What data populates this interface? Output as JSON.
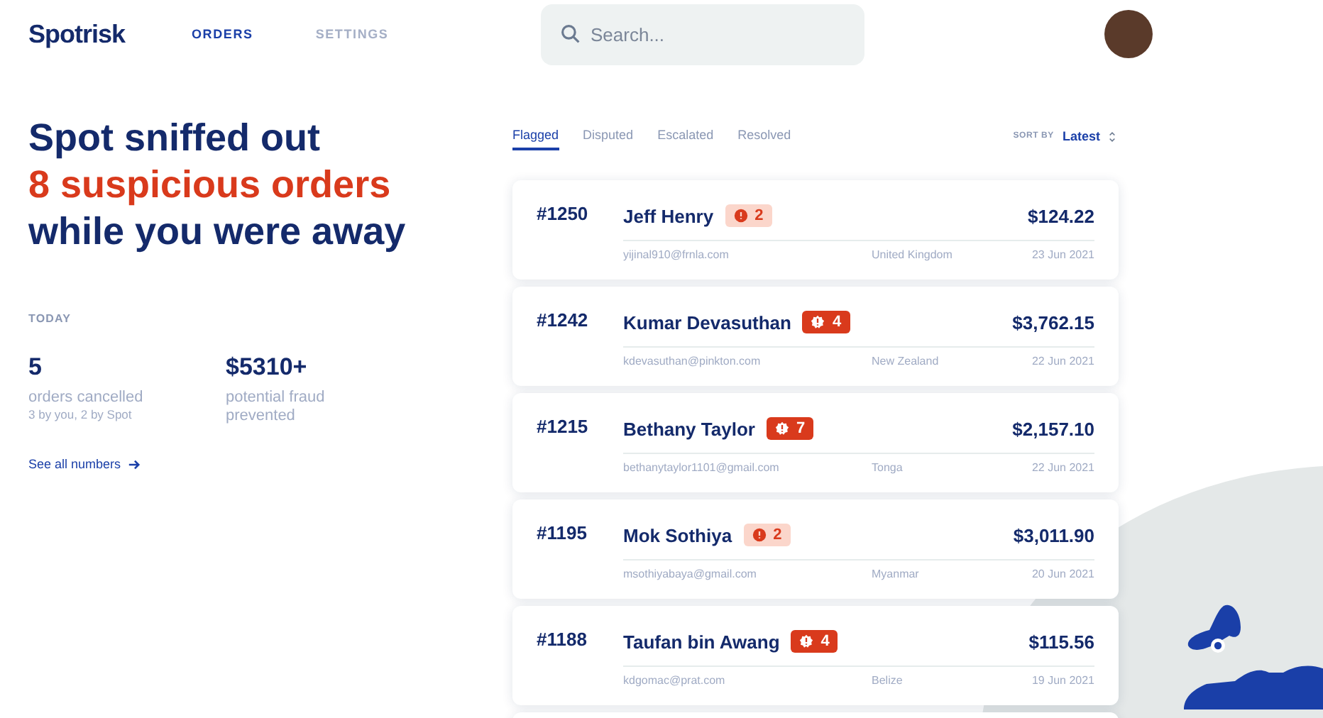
{
  "header": {
    "logo": "Spotrisk",
    "nav": [
      {
        "label": "ORDERS",
        "selected": true
      },
      {
        "label": "SETTINGS",
        "selected": false
      }
    ],
    "search": {
      "placeholder": "Search..."
    }
  },
  "headline": {
    "line_1": "Spot sniffed out",
    "line_2": "8 suspicious orders",
    "line_3": "while you were away"
  },
  "today": {
    "label": "TODAY",
    "stats": [
      {
        "value": "5",
        "label": "orders cancelled",
        "note": "3 by you, 2 by Spot"
      },
      {
        "value": "$5310+",
        "label": "potential fraud prevented"
      }
    ],
    "link": "See all numbers"
  },
  "tabs": [
    {
      "label": "Flagged",
      "selected": true
    },
    {
      "label": "Disputed",
      "selected": false
    },
    {
      "label": "Escalated",
      "selected": false
    },
    {
      "label": "Resolved",
      "selected": false
    }
  ],
  "sort": {
    "label": "SORT BY",
    "value": "Latest"
  },
  "orders": [
    {
      "id": "#1250",
      "name": "Jeff Henry",
      "kind": "low",
      "flags": "2",
      "amount": "$124.22",
      "email": "yijinal910@frnla.com",
      "country": "United Kingdom",
      "date": "23 Jun 2021"
    },
    {
      "id": "#1242",
      "name": "Kumar Devasuthan",
      "kind": "high",
      "flags": "4",
      "amount": "$3,762.15",
      "email": "kdevasuthan@pinkton.com",
      "country": "New Zealand",
      "date": "22 Jun 2021"
    },
    {
      "id": "#1215",
      "name": "Bethany Taylor",
      "kind": "high",
      "flags": "7",
      "amount": "$2,157.10",
      "email": "bethanytaylor1101@gmail.com",
      "country": "Tonga",
      "date": "22 Jun 2021"
    },
    {
      "id": "#1195",
      "name": "Mok Sothiya",
      "kind": "low",
      "flags": "2",
      "amount": "$3,011.90",
      "email": "msothiyabaya@gmail.com",
      "country": "Myanmar",
      "date": "20 Jun 2021"
    },
    {
      "id": "#1188",
      "name": "Taufan bin Awang",
      "kind": "high",
      "flags": "4",
      "amount": "$115.56",
      "email": "kdgomac@prat.com",
      "country": "Belize",
      "date": "19 Jun 2021"
    }
  ]
}
